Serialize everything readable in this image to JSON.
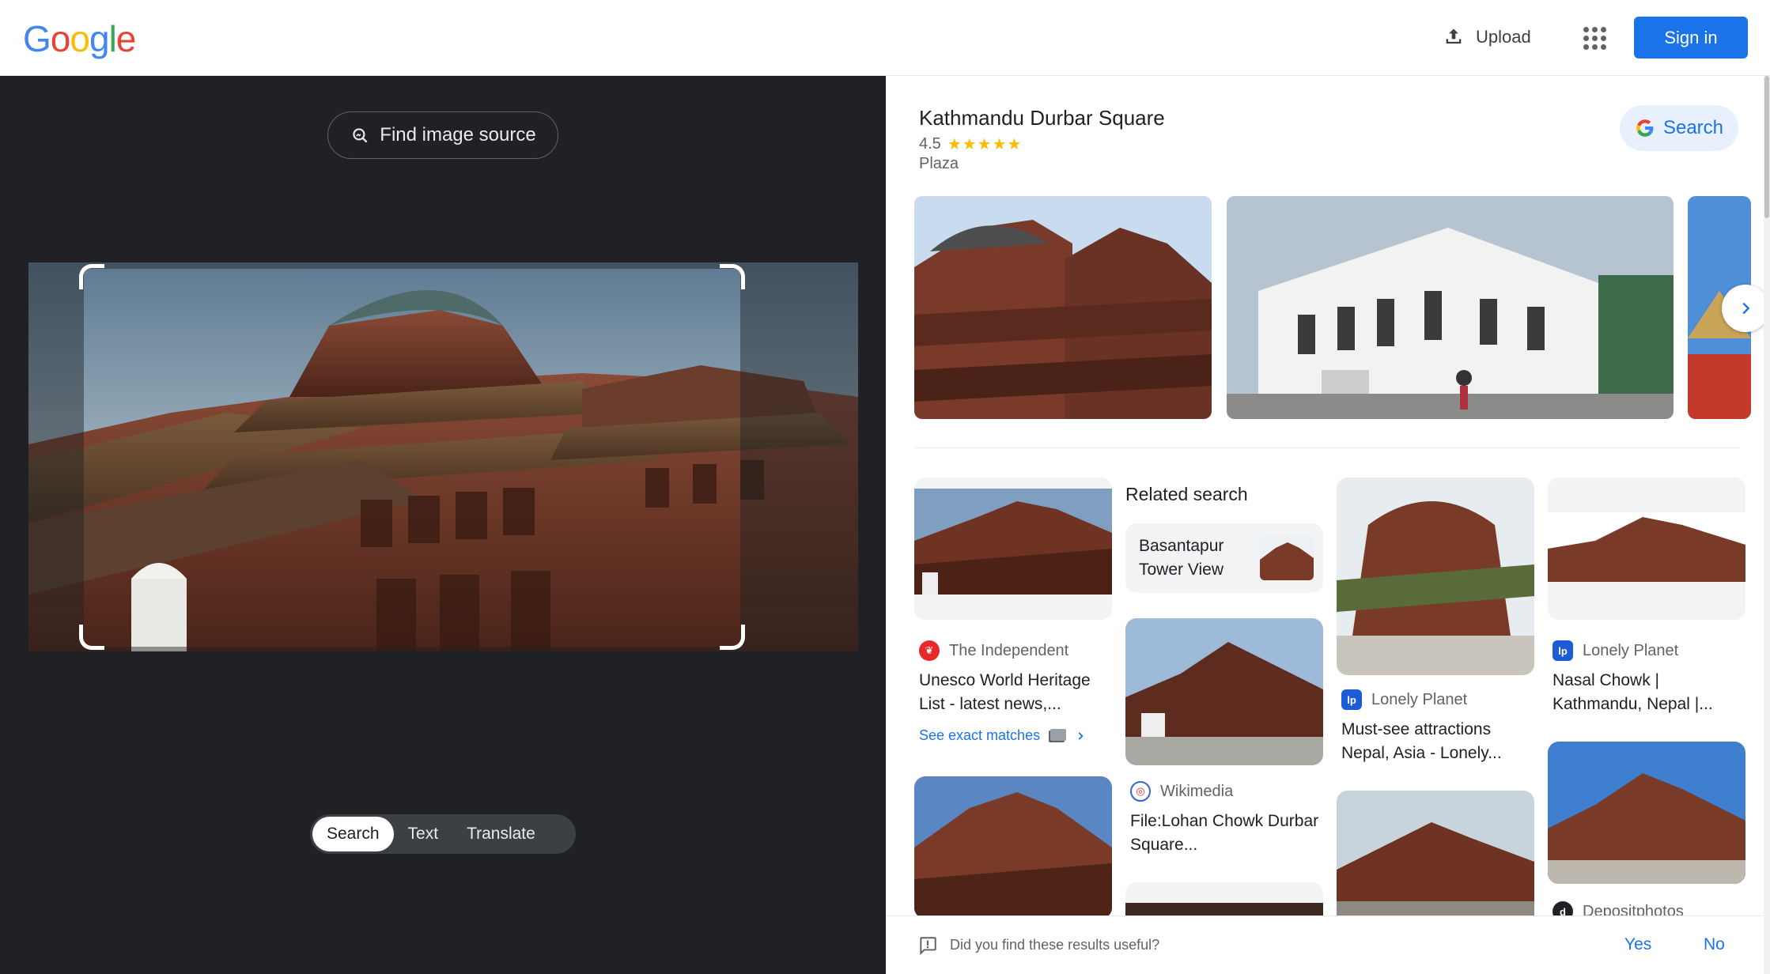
{
  "header": {
    "logo_letters": [
      "G",
      "o",
      "o",
      "g",
      "l",
      "e"
    ],
    "upload_label": "Upload",
    "upload_icon": "upload-icon",
    "apps_icon": "apps-grid-icon",
    "signin_label": "Sign in"
  },
  "lens": {
    "find_source_label": "Find image source",
    "find_source_icon": "image-search-icon",
    "modes": [
      {
        "label": "Search",
        "active": true
      },
      {
        "label": "Text",
        "active": false
      },
      {
        "label": "Translate",
        "active": false
      }
    ]
  },
  "knowledge_panel": {
    "title": "Kathmandu Durbar Square",
    "rating": "4.5",
    "stars": "★★★★★",
    "type": "Plaza",
    "search_label": "Search",
    "next_icon": "chevron-right-icon"
  },
  "results": {
    "related_heading": "Related search",
    "related_chip_label": "Basantapur Tower View",
    "items": [
      {
        "source": "The Independent",
        "title": "Unesco World Heritage List - latest news,...",
        "icon_color": "#e8282b",
        "icon_glyph": "❦"
      },
      {
        "source": "Wikimedia",
        "title": "File:Lohan Chowk Durbar Square...",
        "icon_color": "#ffffff",
        "icon_glyph": "◎"
      },
      {
        "source": "Lonely Planet",
        "title": "Must-see attractions Nepal, Asia - Lonely...",
        "icon_color": "#1e5bd6",
        "icon_glyph": "lp"
      },
      {
        "source": "Lonely Planet",
        "title": "Nasal Chowk | Kathmandu, Nepal |...",
        "icon_color": "#1e5bd6",
        "icon_glyph": "lp"
      },
      {
        "source": "Depositphotos",
        "title": "",
        "icon_color": "#202124",
        "icon_glyph": "d"
      }
    ],
    "exact_matches_label": "See exact matches"
  },
  "feedback": {
    "question": "Did you find these results useful?",
    "yes_label": "Yes",
    "no_label": "No"
  }
}
